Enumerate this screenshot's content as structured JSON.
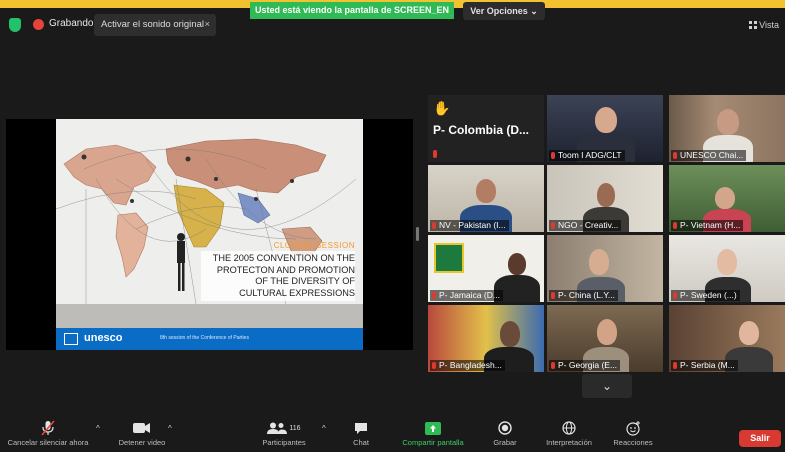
{
  "topbar": {
    "recording_label": "Grabando",
    "original_sound_button": "Activar el sonido original",
    "share_banner": "Usted está viendo la pantalla de SCREEN_EN",
    "view_options": "Ver Opciones",
    "view_label": "Vista"
  },
  "slide": {
    "tag": "CLOSING SESSION",
    "title": "THE 2005 CONVENTION ON THE PROTECTON AND PROMOTION OF THE DIVERSITY OF CULTURAL EXPRESSIONS",
    "brand": "unesco",
    "footer_small": "8th session of the Conference of Parties"
  },
  "gallery": {
    "first_tile_label": "P- Colombia (D...",
    "tiles": [
      {
        "name": "Toom I ADG/CLT"
      },
      {
        "name": "UNESCO Chai..."
      },
      {
        "name": "NV - Pakistan (I..."
      },
      {
        "name": "NGO - Creativ..."
      },
      {
        "name": "P- Vietnam (H..."
      },
      {
        "name": "P- Jamaica (D..."
      },
      {
        "name": "P- China (L.Y..."
      },
      {
        "name": "P- Sweden (...)"
      },
      {
        "name": "P- Bangladesh..."
      },
      {
        "name": "P- Georgia (E..."
      },
      {
        "name": "P- Serbia (M..."
      }
    ]
  },
  "toolbar": {
    "mute": "Cancelar silenciar ahora",
    "video": "Detener video",
    "participants": "Participantes",
    "participants_count": "116",
    "chat": "Chat",
    "share": "Compartir pantalla",
    "record": "Grabar",
    "interpretation": "Interpretación",
    "reactions": "Reacciones",
    "leave": "Salir"
  },
  "colors": {
    "recording": "#e6443a",
    "share_green": "#2fba55",
    "active_speaker": "#c8e04a",
    "leave_red": "#d83a32",
    "unesco_blue": "#0b6cc5"
  }
}
